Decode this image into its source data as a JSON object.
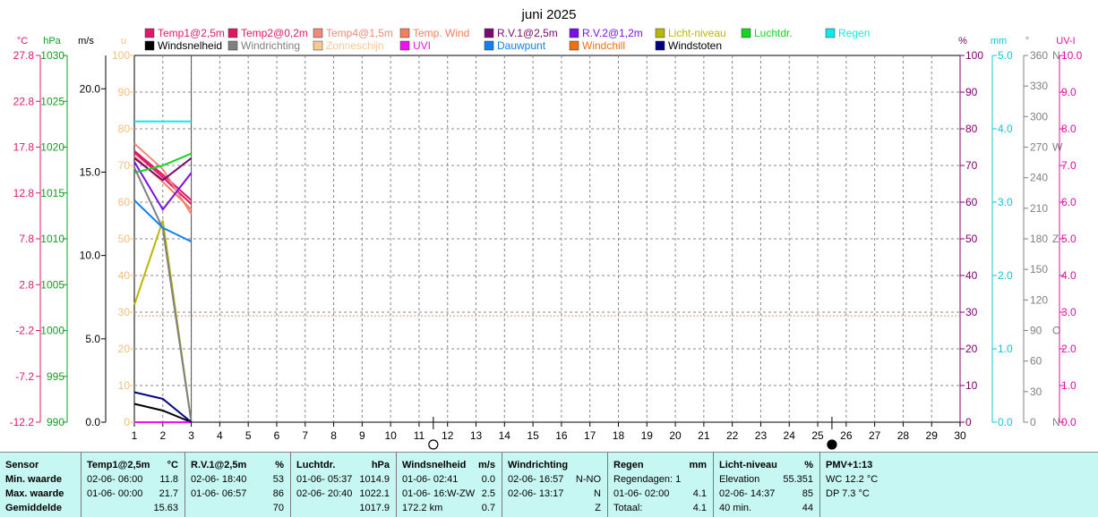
{
  "title": "juni 2025",
  "legend": [
    {
      "label": "Temp1@2,5m",
      "color": "#e0186e"
    },
    {
      "label": "Temp2@0,2m",
      "color": "#e01864"
    },
    {
      "label": "Temp4@1,5m",
      "color": "#f08a7a"
    },
    {
      "label": "Temp. Wind",
      "color": "#f08060"
    },
    {
      "label": "R.V.1@2,5m",
      "color": "#7a0a6e"
    },
    {
      "label": "R.V.2@1,2m",
      "color": "#7a10e8"
    },
    {
      "label": "Licht-niveau",
      "color": "#b8b800"
    },
    {
      "label": "Luchtdr.",
      "color": "#10d820"
    },
    {
      "label": "Regen",
      "color": "#10e8e8"
    },
    {
      "label": "Windsnelheid",
      "color": "#000000"
    },
    {
      "label": "Windrichting",
      "color": "#808080"
    },
    {
      "label": "Zonneschijn",
      "color": "#f8c890"
    },
    {
      "label": "UVI",
      "color": "#f010f0"
    },
    {
      "label": "Dauwpunt",
      "color": "#1080f0"
    },
    {
      "label": "Windchill",
      "color": "#f07010"
    },
    {
      "label": "Windstoten",
      "color": "#000080"
    }
  ],
  "axes": {
    "temp": {
      "unit": "°C",
      "color": "#e0186e",
      "ticks": [
        "27.8",
        "22.8",
        "17.8",
        "12.8",
        "7.8",
        "2.8",
        "-2.2",
        "-7.2",
        "-12.2"
      ]
    },
    "hpa": {
      "unit": "hPa",
      "color": "#10a020",
      "ticks": [
        "1030",
        "1025",
        "1020",
        "1015",
        "1010",
        "1005",
        "1000",
        "995",
        "990"
      ]
    },
    "ms": {
      "unit": "m/s",
      "color": "#000000",
      "ticks": [
        "20.0",
        "15.0",
        "10.0",
        "5.0",
        "0.0"
      ]
    },
    "u": {
      "unit": "u",
      "color": "#f0c080",
      "ticks": [
        "100",
        "90",
        "80",
        "70",
        "60",
        "50",
        "40",
        "30",
        "20",
        "10",
        "0"
      ]
    },
    "pct": {
      "unit": "%",
      "color": "#800070",
      "ticks": [
        "100",
        "90",
        "80",
        "70",
        "60",
        "50",
        "40",
        "30",
        "20",
        "10",
        "0"
      ]
    },
    "mm": {
      "unit": "mm",
      "color": "#10c8d0",
      "ticks": [
        "5.0",
        "4.0",
        "3.0",
        "2.0",
        "1.0",
        "0.0"
      ]
    },
    "deg": {
      "unit": "°",
      "color": "#808080",
      "ticks": [
        "360",
        "330",
        "300",
        "270",
        "240",
        "210",
        "180",
        "150",
        "120",
        "90",
        "60",
        "30",
        "0"
      ],
      "compass": [
        "N",
        "W",
        "Z",
        "O",
        "N"
      ]
    },
    "uvi": {
      "unit": "UV-I",
      "color": "#e010a0",
      "ticks": [
        "10.0",
        "9.0",
        "8.0",
        "7.0",
        "6.0",
        "5.0",
        "4.0",
        "3.0",
        "2.0",
        "1.0",
        "0.0"
      ]
    }
  },
  "chart_data": {
    "type": "line",
    "title": "juni 2025",
    "x": [
      1,
      2,
      3
    ],
    "xlim": [
      1,
      30
    ],
    "x_ticks": [
      "1",
      "2",
      "3",
      "4",
      "5",
      "6",
      "7",
      "8",
      "9",
      "10",
      "11",
      "12",
      "13",
      "14",
      "15",
      "16",
      "17",
      "18",
      "19",
      "20",
      "21",
      "22",
      "23",
      "24",
      "25",
      "26",
      "27",
      "28",
      "29",
      "30"
    ],
    "series": [
      {
        "name": "Temp1@2,5m",
        "axis": "temp",
        "color": "#e0186e",
        "values": [
          17.4,
          14.8,
          12.0
        ]
      },
      {
        "name": "Temp2@0,2m",
        "axis": "temp",
        "color": "#e01864",
        "values": [
          17.2,
          14.5,
          11.6
        ]
      },
      {
        "name": "Temp4@1,5m",
        "axis": "temp",
        "color": "#f08a7a",
        "values": [
          18.2,
          15.4,
          10.5
        ]
      },
      {
        "name": "Temp. Wind",
        "axis": "temp",
        "color": "#f08060",
        "values": [
          16.8,
          14.0,
          11.0
        ]
      },
      {
        "name": "R.V.1@2,5m",
        "axis": "pct",
        "color": "#7a0a6e",
        "values": [
          72,
          66,
          72
        ]
      },
      {
        "name": "R.V.2@1,2m",
        "axis": "pct",
        "color": "#7a10e8",
        "values": [
          71,
          58,
          68
        ]
      },
      {
        "name": "Licht-niveau",
        "axis": "pct",
        "color": "#b8b800",
        "values": [
          32,
          55,
          0
        ]
      },
      {
        "name": "Luchtdr.",
        "axis": "hpa",
        "color": "#10d820",
        "values": [
          1017.2,
          1018.0,
          1019.3
        ]
      },
      {
        "name": "Regen",
        "axis": "mm",
        "color": "#10e8e8",
        "values": [
          4.1,
          4.1,
          4.1
        ]
      },
      {
        "name": "Windsnelheid",
        "axis": "ms",
        "color": "#000000",
        "values": [
          1.1,
          0.7,
          0.0
        ]
      },
      {
        "name": "Windrichting",
        "axis": "deg",
        "color": "#808080",
        "values": [
          250,
          190,
          0
        ]
      },
      {
        "name": "UVI",
        "axis": "uvi",
        "color": "#f010f0",
        "values": [
          0.0,
          0.0,
          0.0
        ]
      },
      {
        "name": "Dauwpunt",
        "axis": "temp",
        "color": "#1080f0",
        "values": [
          12.0,
          9.0,
          7.5
        ]
      },
      {
        "name": "Windstoten",
        "axis": "ms",
        "color": "#000080",
        "values": [
          1.8,
          1.4,
          0.0
        ]
      }
    ],
    "reference_line": {
      "axis": "pct",
      "value": 29,
      "color": "#f08a7a"
    },
    "moon_markers": [
      {
        "day": 11.5,
        "phase": "full"
      },
      {
        "day": 25.5,
        "phase": "new"
      }
    ]
  },
  "table": [
    {
      "header": [
        "Sensor"
      ],
      "rows": [
        [
          "Min. waarde"
        ],
        [
          "Max. waarde"
        ],
        [
          "Gemiddelde"
        ]
      ]
    },
    {
      "header": [
        "Temp1@2,5m",
        "°C"
      ],
      "rows": [
        [
          "02-06-  06:00",
          "11.8"
        ],
        [
          "01-06-  00:00",
          "21.7"
        ],
        [
          "",
          "15.63"
        ]
      ]
    },
    {
      "header": [
        "R.V.1@2,5m",
        "%"
      ],
      "rows": [
        [
          "02-06-  18:40",
          "53"
        ],
        [
          "01-06-  06:57",
          "86"
        ],
        [
          "",
          "70"
        ]
      ]
    },
    {
      "header": [
        "Luchtdr.",
        "hPa"
      ],
      "rows": [
        [
          "01-06-  05:37",
          "1014.9"
        ],
        [
          "02-06-  20:40",
          "1022.1"
        ],
        [
          "",
          "1017.9"
        ]
      ]
    },
    {
      "header": [
        "Windsnelheid",
        "m/s"
      ],
      "rows": [
        [
          "01-06-  02:41",
          "0.0"
        ],
        [
          "01-06-  16:W-ZW",
          "2.5"
        ],
        [
          "172.2 km",
          "0.7"
        ]
      ]
    },
    {
      "header": [
        "Windrichting",
        ""
      ],
      "rows": [
        [
          "02-06-  16:57",
          "N-NO"
        ],
        [
          "02-06-  13:17",
          "N"
        ],
        [
          "",
          "Z"
        ]
      ]
    },
    {
      "header": [
        "Regen",
        "mm"
      ],
      "rows": [
        [
          "Regendagen: 1",
          ""
        ],
        [
          "01-06-  02:00",
          "4.1"
        ],
        [
          "Totaal:",
          "4.1"
        ]
      ]
    },
    {
      "header": [
        "Licht-niveau",
        "%"
      ],
      "rows": [
        [
          "Elevation",
          "55.351"
        ],
        [
          "02-06-  14:37",
          "85"
        ],
        [
          "40 min.",
          "44"
        ]
      ]
    },
    {
      "header": [
        "PMV+1:13",
        ""
      ],
      "rows": [
        [
          "WC 12.2 °C",
          ""
        ],
        [
          "DP 7.3 °C",
          ""
        ],
        [
          "",
          ""
        ]
      ]
    }
  ]
}
